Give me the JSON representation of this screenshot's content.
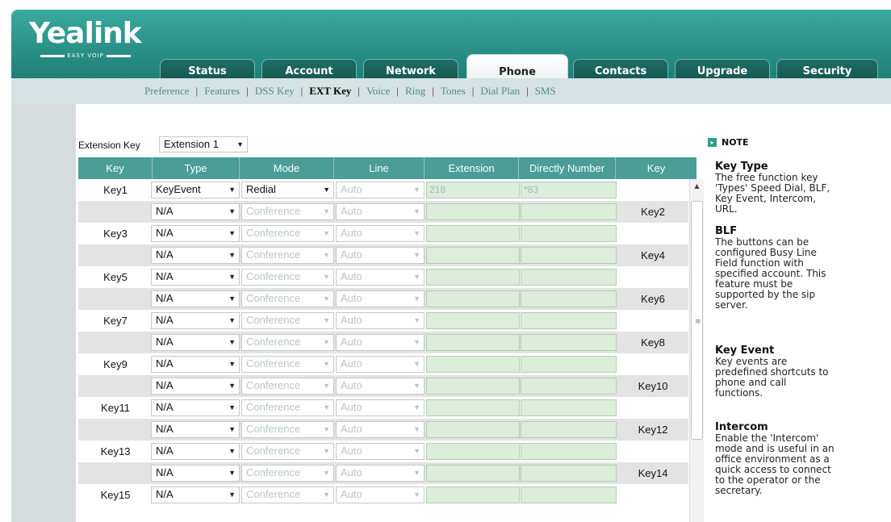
{
  "header": {
    "logo": "Yealink",
    "logo_sub": "EASY VOIP",
    "tabs": [
      "Status",
      "Account",
      "Network",
      "Phone",
      "Contacts",
      "Upgrade",
      "Security"
    ],
    "active_tab": "Phone"
  },
  "subnav": {
    "items": [
      "Preference",
      "Features",
      "DSS Key",
      "EXT Key",
      "Voice",
      "Ring",
      "Tones",
      "Dial Plan",
      "SMS"
    ],
    "active": "EXT Key"
  },
  "extension_key": {
    "label": "Extension Key",
    "value": "Extension 1"
  },
  "table": {
    "headers": [
      "Key",
      "Type",
      "Mode",
      "Line",
      "Extension",
      "Directly Number",
      "Key"
    ],
    "rows": [
      {
        "left": "Key1",
        "right": "",
        "type": "KeyEvent",
        "mode": "Redial",
        "mode_enabled": true,
        "line": "Auto",
        "extension": "218",
        "direct": "*83"
      },
      {
        "left": "",
        "right": "Key2",
        "type": "N/A",
        "mode": "Conference",
        "mode_enabled": false,
        "line": "Auto",
        "extension": "",
        "direct": ""
      },
      {
        "left": "Key3",
        "right": "",
        "type": "N/A",
        "mode": "Conference",
        "mode_enabled": false,
        "line": "Auto",
        "extension": "",
        "direct": ""
      },
      {
        "left": "",
        "right": "Key4",
        "type": "N/A",
        "mode": "Conference",
        "mode_enabled": false,
        "line": "Auto",
        "extension": "",
        "direct": ""
      },
      {
        "left": "Key5",
        "right": "",
        "type": "N/A",
        "mode": "Conference",
        "mode_enabled": false,
        "line": "Auto",
        "extension": "",
        "direct": ""
      },
      {
        "left": "",
        "right": "Key6",
        "type": "N/A",
        "mode": "Conference",
        "mode_enabled": false,
        "line": "Auto",
        "extension": "",
        "direct": ""
      },
      {
        "left": "Key7",
        "right": "",
        "type": "N/A",
        "mode": "Conference",
        "mode_enabled": false,
        "line": "Auto",
        "extension": "",
        "direct": ""
      },
      {
        "left": "",
        "right": "Key8",
        "type": "N/A",
        "mode": "Conference",
        "mode_enabled": false,
        "line": "Auto",
        "extension": "",
        "direct": ""
      },
      {
        "left": "Key9",
        "right": "",
        "type": "N/A",
        "mode": "Conference",
        "mode_enabled": false,
        "line": "Auto",
        "extension": "",
        "direct": ""
      },
      {
        "left": "",
        "right": "Key10",
        "type": "N/A",
        "mode": "Conference",
        "mode_enabled": false,
        "line": "Auto",
        "extension": "",
        "direct": ""
      },
      {
        "left": "Key11",
        "right": "",
        "type": "N/A",
        "mode": "Conference",
        "mode_enabled": false,
        "line": "Auto",
        "extension": "",
        "direct": ""
      },
      {
        "left": "",
        "right": "Key12",
        "type": "N/A",
        "mode": "Conference",
        "mode_enabled": false,
        "line": "Auto",
        "extension": "",
        "direct": ""
      },
      {
        "left": "Key13",
        "right": "",
        "type": "N/A",
        "mode": "Conference",
        "mode_enabled": false,
        "line": "Auto",
        "extension": "",
        "direct": ""
      },
      {
        "left": "",
        "right": "Key14",
        "type": "N/A",
        "mode": "Conference",
        "mode_enabled": false,
        "line": "Auto",
        "extension": "",
        "direct": ""
      },
      {
        "left": "Key15",
        "right": "",
        "type": "N/A",
        "mode": "Conference",
        "mode_enabled": false,
        "line": "Auto",
        "extension": "",
        "direct": ""
      }
    ]
  },
  "note": {
    "heading": "NOTE",
    "sections": [
      {
        "title": "Key Type",
        "lines": [
          "The free function key",
          "'Types' Speed Dial, BLF,",
          "Key Event, Intercom,",
          "URL."
        ]
      },
      {
        "title": "BLF",
        "lines": [
          "The buttons can be",
          "configured Busy Line",
          "Field function with",
          "specified account. This",
          "feature must be",
          "supported by the sip",
          "server."
        ]
      },
      {
        "title": "Key Event",
        "lines": [
          "Key events are",
          "predefined shortcuts to",
          "phone and call",
          "functions."
        ]
      },
      {
        "title": "Intercom",
        "lines": [
          "Enable the 'Intercom'",
          "mode and is useful in an",
          "office environment as a",
          "quick access to connect",
          "to the operator or the",
          "secretary."
        ]
      }
    ]
  },
  "icons": {
    "dropdown": "chevron-down-icon",
    "note": "note-icon",
    "scroll_up": "scroll-up-icon"
  },
  "colors": {
    "header": "#2a8f86",
    "table_header": "#4b9d97",
    "input_bg": "#dcedda",
    "subnav_link": "#4d8f8a"
  }
}
